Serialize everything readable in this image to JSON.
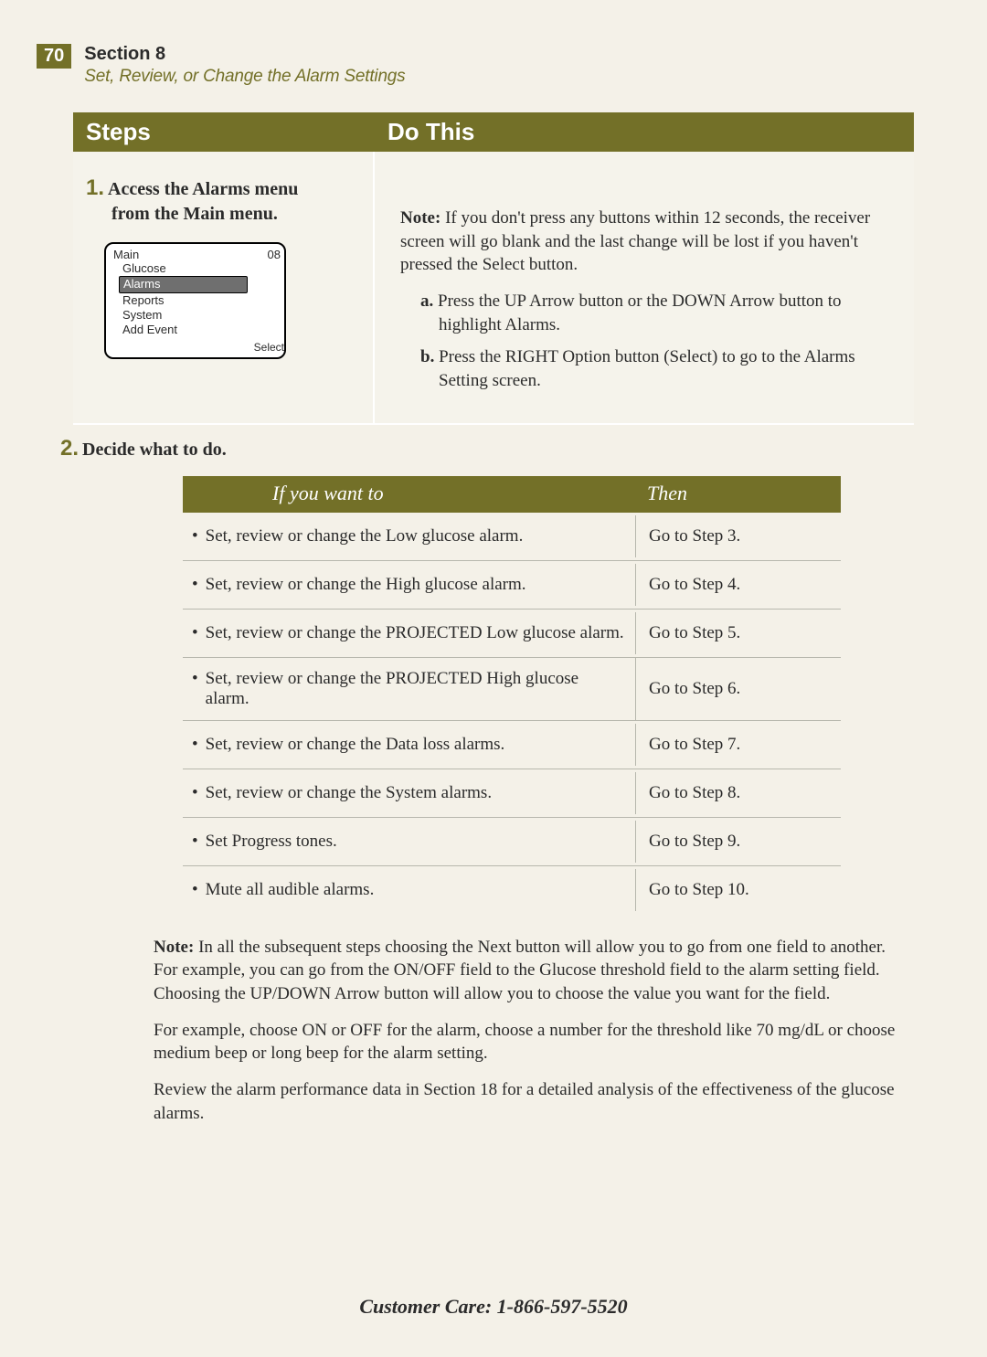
{
  "header": {
    "page_number": "70",
    "section_label": "Section 8",
    "subtitle": "Set, Review, or Change the Alarm Settings"
  },
  "columns": {
    "steps_label": "Steps",
    "do_label": "Do This"
  },
  "step1": {
    "number": "1.",
    "title_line1": "Access the Alarms menu",
    "title_line2": "from the Main menu.",
    "device": {
      "title": "Main",
      "clock": "08",
      "items": [
        "Glucose",
        "Alarms",
        "Reports",
        "System",
        "Add Event"
      ],
      "selected_index": 1,
      "footer": "Select"
    },
    "note_label": "Note:",
    "note_text": " If you don't press any buttons within 12 seconds, the receiver screen will go blank and the last change will be lost if you haven't pressed the Select button.",
    "sub_a_label": "a.",
    "sub_a_text": " Press the UP Arrow button or the DOWN Arrow button to highlight Alarms.",
    "sub_b_label": "b.",
    "sub_b_text": " Press the RIGHT Option button (Select) to go to the Alarms Setting screen."
  },
  "step2": {
    "number": "2.",
    "title": "Decide what to do."
  },
  "decision_table": {
    "head_if": "If you want to",
    "head_then": "Then",
    "rows": [
      {
        "if": "Set, review or change the Low glucose alarm.",
        "then": "Go to Step 3."
      },
      {
        "if": "Set, review or change the High glucose alarm.",
        "then": "Go to Step 4."
      },
      {
        "if": "Set, review or change the PROJECTED Low glucose alarm.",
        "then": "Go to Step 5."
      },
      {
        "if": "Set, review or change the PROJECTED High glucose alarm.",
        "then": "Go to Step 6."
      },
      {
        "if": "Set, review or change the Data loss alarms.",
        "then": "Go to Step 7."
      },
      {
        "if": "Set, review or change the System alarms.",
        "then": "Go to Step 8."
      },
      {
        "if": "Set Progress tones.",
        "then": "Go to Step 9."
      },
      {
        "if": "Mute all audible alarms.",
        "then": "Go to Step 10."
      }
    ]
  },
  "closing": {
    "note_label": "Note:",
    "p1": " In all the subsequent steps choosing the Next button will allow you to go from one field to another. For example, you can go from the ON/OFF field to the Glucose threshold field to the alarm setting field. Choosing the UP/DOWN Arrow button will allow you to choose the value you want for the field.",
    "p2": "For example, choose ON or OFF for the alarm, choose a number for the threshold like 70 mg/dL or choose medium beep or long beep for the alarm setting.",
    "p3": "Review the alarm performance data in Section 18 for a detailed analysis of the effectiveness of the glucose alarms."
  },
  "footer": "Customer Care: 1-866-597-5520"
}
